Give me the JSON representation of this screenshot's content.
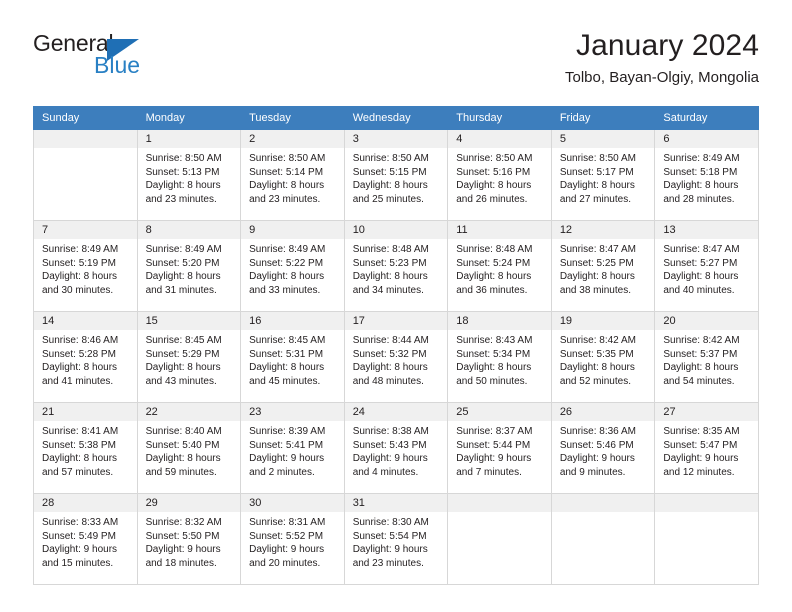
{
  "brand": {
    "name_part1": "General",
    "name_part2": "Blue"
  },
  "header": {
    "title": "January 2024",
    "subtitle": "Tolbo, Bayan-Olgiy, Mongolia"
  },
  "colors": {
    "header_blue": "#3d7ebd",
    "logo_blue": "#2980c4",
    "daynum_band": "#f0f0f0",
    "grid_line": "#d7d7d7",
    "text": "#231f20"
  },
  "weekday_headers": [
    "Sunday",
    "Monday",
    "Tuesday",
    "Wednesday",
    "Thursday",
    "Friday",
    "Saturday"
  ],
  "weeks": [
    [
      {
        "day": "",
        "lines": []
      },
      {
        "day": "1",
        "lines": [
          "Sunrise: 8:50 AM",
          "Sunset: 5:13 PM",
          "Daylight: 8 hours",
          "and 23 minutes."
        ]
      },
      {
        "day": "2",
        "lines": [
          "Sunrise: 8:50 AM",
          "Sunset: 5:14 PM",
          "Daylight: 8 hours",
          "and 23 minutes."
        ]
      },
      {
        "day": "3",
        "lines": [
          "Sunrise: 8:50 AM",
          "Sunset: 5:15 PM",
          "Daylight: 8 hours",
          "and 25 minutes."
        ]
      },
      {
        "day": "4",
        "lines": [
          "Sunrise: 8:50 AM",
          "Sunset: 5:16 PM",
          "Daylight: 8 hours",
          "and 26 minutes."
        ]
      },
      {
        "day": "5",
        "lines": [
          "Sunrise: 8:50 AM",
          "Sunset: 5:17 PM",
          "Daylight: 8 hours",
          "and 27 minutes."
        ]
      },
      {
        "day": "6",
        "lines": [
          "Sunrise: 8:49 AM",
          "Sunset: 5:18 PM",
          "Daylight: 8 hours",
          "and 28 minutes."
        ]
      }
    ],
    [
      {
        "day": "7",
        "lines": [
          "Sunrise: 8:49 AM",
          "Sunset: 5:19 PM",
          "Daylight: 8 hours",
          "and 30 minutes."
        ]
      },
      {
        "day": "8",
        "lines": [
          "Sunrise: 8:49 AM",
          "Sunset: 5:20 PM",
          "Daylight: 8 hours",
          "and 31 minutes."
        ]
      },
      {
        "day": "9",
        "lines": [
          "Sunrise: 8:49 AM",
          "Sunset: 5:22 PM",
          "Daylight: 8 hours",
          "and 33 minutes."
        ]
      },
      {
        "day": "10",
        "lines": [
          "Sunrise: 8:48 AM",
          "Sunset: 5:23 PM",
          "Daylight: 8 hours",
          "and 34 minutes."
        ]
      },
      {
        "day": "11",
        "lines": [
          "Sunrise: 8:48 AM",
          "Sunset: 5:24 PM",
          "Daylight: 8 hours",
          "and 36 minutes."
        ]
      },
      {
        "day": "12",
        "lines": [
          "Sunrise: 8:47 AM",
          "Sunset: 5:25 PM",
          "Daylight: 8 hours",
          "and 38 minutes."
        ]
      },
      {
        "day": "13",
        "lines": [
          "Sunrise: 8:47 AM",
          "Sunset: 5:27 PM",
          "Daylight: 8 hours",
          "and 40 minutes."
        ]
      }
    ],
    [
      {
        "day": "14",
        "lines": [
          "Sunrise: 8:46 AM",
          "Sunset: 5:28 PM",
          "Daylight: 8 hours",
          "and 41 minutes."
        ]
      },
      {
        "day": "15",
        "lines": [
          "Sunrise: 8:45 AM",
          "Sunset: 5:29 PM",
          "Daylight: 8 hours",
          "and 43 minutes."
        ]
      },
      {
        "day": "16",
        "lines": [
          "Sunrise: 8:45 AM",
          "Sunset: 5:31 PM",
          "Daylight: 8 hours",
          "and 45 minutes."
        ]
      },
      {
        "day": "17",
        "lines": [
          "Sunrise: 8:44 AM",
          "Sunset: 5:32 PM",
          "Daylight: 8 hours",
          "and 48 minutes."
        ]
      },
      {
        "day": "18",
        "lines": [
          "Sunrise: 8:43 AM",
          "Sunset: 5:34 PM",
          "Daylight: 8 hours",
          "and 50 minutes."
        ]
      },
      {
        "day": "19",
        "lines": [
          "Sunrise: 8:42 AM",
          "Sunset: 5:35 PM",
          "Daylight: 8 hours",
          "and 52 minutes."
        ]
      },
      {
        "day": "20",
        "lines": [
          "Sunrise: 8:42 AM",
          "Sunset: 5:37 PM",
          "Daylight: 8 hours",
          "and 54 minutes."
        ]
      }
    ],
    [
      {
        "day": "21",
        "lines": [
          "Sunrise: 8:41 AM",
          "Sunset: 5:38 PM",
          "Daylight: 8 hours",
          "and 57 minutes."
        ]
      },
      {
        "day": "22",
        "lines": [
          "Sunrise: 8:40 AM",
          "Sunset: 5:40 PM",
          "Daylight: 8 hours",
          "and 59 minutes."
        ]
      },
      {
        "day": "23",
        "lines": [
          "Sunrise: 8:39 AM",
          "Sunset: 5:41 PM",
          "Daylight: 9 hours",
          "and 2 minutes."
        ]
      },
      {
        "day": "24",
        "lines": [
          "Sunrise: 8:38 AM",
          "Sunset: 5:43 PM",
          "Daylight: 9 hours",
          "and 4 minutes."
        ]
      },
      {
        "day": "25",
        "lines": [
          "Sunrise: 8:37 AM",
          "Sunset: 5:44 PM",
          "Daylight: 9 hours",
          "and 7 minutes."
        ]
      },
      {
        "day": "26",
        "lines": [
          "Sunrise: 8:36 AM",
          "Sunset: 5:46 PM",
          "Daylight: 9 hours",
          "and 9 minutes."
        ]
      },
      {
        "day": "27",
        "lines": [
          "Sunrise: 8:35 AM",
          "Sunset: 5:47 PM",
          "Daylight: 9 hours",
          "and 12 minutes."
        ]
      }
    ],
    [
      {
        "day": "28",
        "lines": [
          "Sunrise: 8:33 AM",
          "Sunset: 5:49 PM",
          "Daylight: 9 hours",
          "and 15 minutes."
        ]
      },
      {
        "day": "29",
        "lines": [
          "Sunrise: 8:32 AM",
          "Sunset: 5:50 PM",
          "Daylight: 9 hours",
          "and 18 minutes."
        ]
      },
      {
        "day": "30",
        "lines": [
          "Sunrise: 8:31 AM",
          "Sunset: 5:52 PM",
          "Daylight: 9 hours",
          "and 20 minutes."
        ]
      },
      {
        "day": "31",
        "lines": [
          "Sunrise: 8:30 AM",
          "Sunset: 5:54 PM",
          "Daylight: 9 hours",
          "and 23 minutes."
        ]
      },
      {
        "day": "",
        "lines": []
      },
      {
        "day": "",
        "lines": []
      },
      {
        "day": "",
        "lines": []
      }
    ]
  ]
}
